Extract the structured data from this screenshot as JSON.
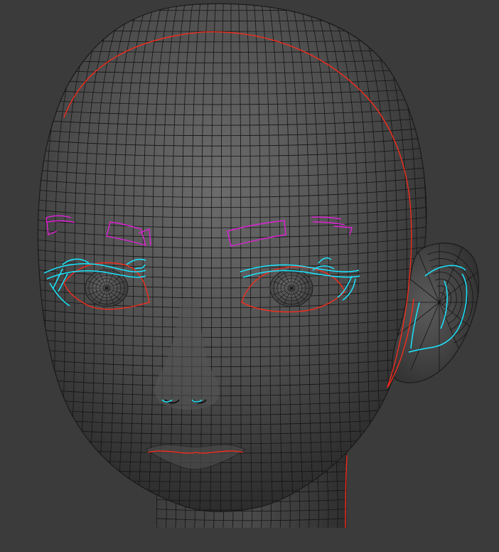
{
  "viewport": {
    "background_color": "#3b3b3b",
    "mesh_shading_light": "#6a6a6a",
    "mesh_shading_dark": "#2a2a2a",
    "wire_color": "#141414",
    "seam_colors": {
      "red": "#ff2a1a",
      "cyan": "#19e6ff",
      "magenta": "#e020d8"
    }
  }
}
